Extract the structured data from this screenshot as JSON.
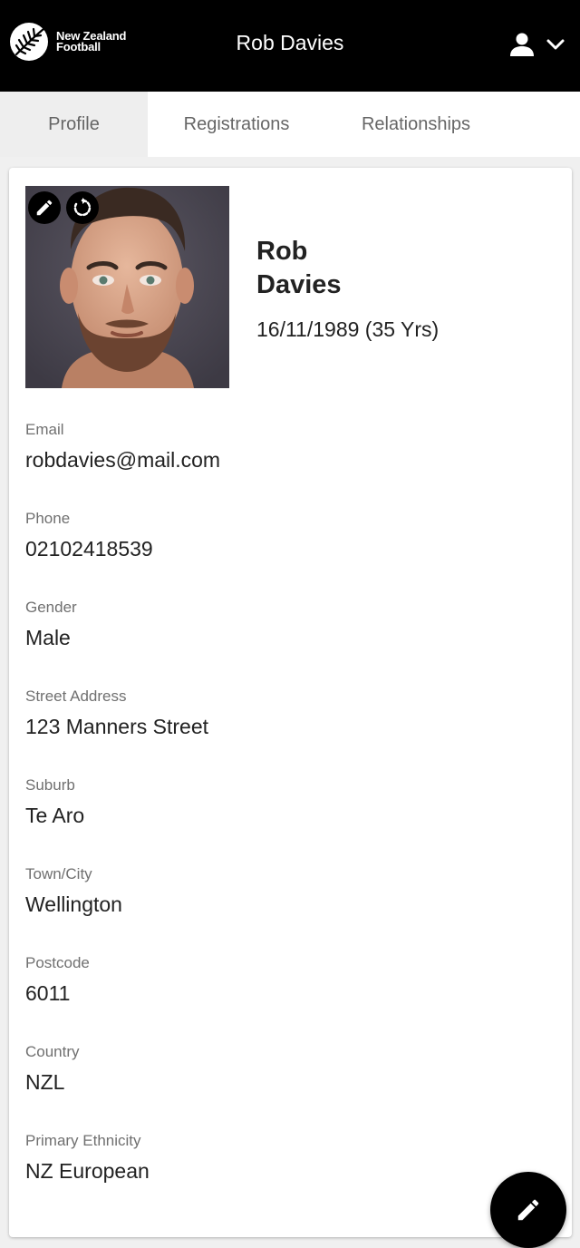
{
  "header": {
    "logo_line1": "New Zealand",
    "logo_line2": "Football",
    "title": "Rob Davies",
    "user_icon": "user-icon",
    "dropdown_icon": "chevron-down-icon"
  },
  "tabs": [
    {
      "label": "Profile",
      "active": true
    },
    {
      "label": "Registrations",
      "active": false
    },
    {
      "label": "Relationships",
      "active": false
    }
  ],
  "profile": {
    "first_name": "Rob",
    "last_name": "Davies",
    "dob": "16/11/1989 (35 Yrs)",
    "photo_actions": [
      "pencil-icon",
      "rotate-icon"
    ]
  },
  "fields": [
    {
      "label": "Email",
      "value": "robdavies@mail.com"
    },
    {
      "label": "Phone",
      "value": "02102418539"
    },
    {
      "label": "Gender",
      "value": "Male"
    },
    {
      "label": "Street Address",
      "value": "123 Manners Street"
    },
    {
      "label": "Suburb",
      "value": "Te Aro"
    },
    {
      "label": "Town/City",
      "value": "Wellington"
    },
    {
      "label": "Postcode",
      "value": "6011"
    },
    {
      "label": "Country",
      "value": "NZL"
    },
    {
      "label": "Primary Ethnicity",
      "value": "NZ European"
    }
  ],
  "colors": {
    "header_bg": "#000000",
    "active_tab_bg": "#eeeeee",
    "label_text": "#707070",
    "value_text": "#222222"
  }
}
